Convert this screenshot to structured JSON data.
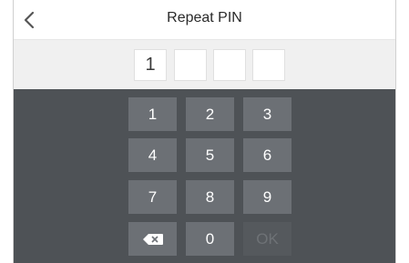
{
  "header": {
    "title": "Repeat PIN",
    "back_icon": "chevron-left-icon"
  },
  "pin": {
    "digits": [
      "1",
      "",
      "",
      ""
    ]
  },
  "keypad": {
    "keys": [
      {
        "label": "1"
      },
      {
        "label": "2"
      },
      {
        "label": "3"
      },
      {
        "label": "4"
      },
      {
        "label": "5"
      },
      {
        "label": "6"
      },
      {
        "label": "7"
      },
      {
        "label": "8"
      },
      {
        "label": "9"
      },
      {
        "icon": "backspace-icon"
      },
      {
        "label": "0"
      },
      {
        "label": "OK",
        "disabled": true
      }
    ]
  },
  "colors": {
    "header_bg": "#ffffff",
    "pinbar_bg": "#f0f0f0",
    "keypad_bg": "#4e5256",
    "key_bg": "#6c7075",
    "key_disabled_bg": "#55595d"
  }
}
